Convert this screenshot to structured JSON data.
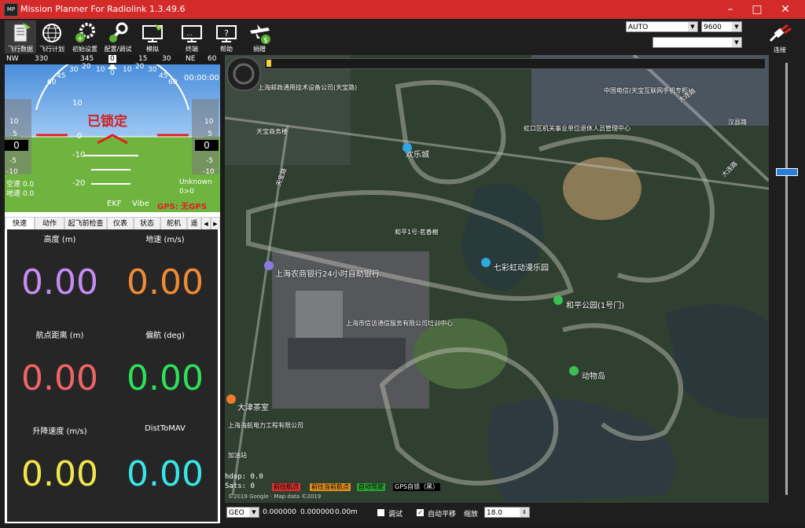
{
  "window": {
    "title": "Mission Planner For Radiolink 1.3.49.6",
    "icon_text": "MP"
  },
  "toolbar": {
    "items": [
      {
        "label": "飞行数据",
        "icon": "flight-data-icon"
      },
      {
        "label": "飞行计划",
        "icon": "flight-plan-icon"
      },
      {
        "label": "初始设置",
        "icon": "initial-setup-icon"
      },
      {
        "label": "配置/调试",
        "icon": "config-tuning-icon"
      },
      {
        "label": "模拟",
        "icon": "simulation-icon"
      },
      {
        "label": "终端",
        "icon": "terminal-icon"
      },
      {
        "label": "帮助",
        "icon": "help-icon"
      },
      {
        "label": "捐赠",
        "icon": "donate-icon"
      }
    ],
    "port_value": "AUTO",
    "baud_value": "9600",
    "profile_value": "",
    "connect_label": "连接"
  },
  "hud": {
    "heading_labels": [
      "NW",
      "330",
      "345",
      "0",
      "15",
      "30",
      "NE",
      "60"
    ],
    "heading_value": "0",
    "time": "00:00:00",
    "status_banner": "已锁定",
    "left_scale": [
      "10",
      "5",
      "-5",
      "-10"
    ],
    "left_box": "0",
    "right_scale": [
      "10",
      "5",
      "-5",
      "-10"
    ],
    "right_box": "0",
    "pitch_labels": [
      "10",
      "0",
      "-10",
      "-20"
    ],
    "roll_labels": [
      "60",
      "45",
      "30",
      "20",
      "10",
      "0",
      "10",
      "20",
      "30",
      "45",
      "60"
    ],
    "airspeed": "空速 0.0",
    "groundspeed": "地速 0.0",
    "unknown": "Unknown",
    "wp": "0>0",
    "ekf": "EKF",
    "vibe": "Vibe",
    "gps": "GPS: 无GPS"
  },
  "tabs": [
    "快速",
    "动作",
    "起飞前检查",
    "仪表",
    "状态",
    "舵机",
    "遥"
  ],
  "quick": [
    {
      "label": "高度 (m)",
      "value": "0.00",
      "color": "#c58cf2"
    },
    {
      "label": "地速 (m/s)",
      "value": "0.00",
      "color": "#f08a34"
    },
    {
      "label": "航点距离 (m)",
      "value": "0.00",
      "color": "#f06464"
    },
    {
      "label": "偏航 (deg)",
      "value": "0.00",
      "color": "#2de05a"
    },
    {
      "label": "升降速度 (m/s)",
      "value": "0.00",
      "color": "#f2e64c"
    },
    {
      "label": "DistToMAV",
      "value": "0.00",
      "color": "#38e6e8"
    }
  ],
  "map": {
    "labels": [
      {
        "text": "上海邮政通用技术设备公司(天宝路)"
      },
      {
        "text": "中国电信(天宝互联网手机专柜)"
      },
      {
        "text": "大连路"
      },
      {
        "text": "天宝商务楼"
      },
      {
        "text": "欢乐城"
      },
      {
        "text": "虹口区机关事业单位退休人员管理中心"
      },
      {
        "text": "天宝路"
      },
      {
        "text": "和平1号·茗香榭"
      },
      {
        "text": "七彩虹动漫乐园"
      },
      {
        "text": "上海农商银行24小时自助银行"
      },
      {
        "text": "和平公园(1号门)"
      },
      {
        "text": "上海市信访通信服务有限公司培训中心"
      },
      {
        "text": "动物岛"
      },
      {
        "text": "大津茶室"
      },
      {
        "text": "上海海航电力工程有限公司"
      },
      {
        "text": "加油站"
      },
      {
        "text": "大连路"
      },
      {
        "text": "汉县路"
      }
    ],
    "hdop": "hdop: 0.0",
    "sats": "Sats: 0",
    "chips": [
      {
        "text": "前往航点",
        "color": "#d93030"
      },
      {
        "text": "前往当前航点",
        "color": "#e09020"
      },
      {
        "text": "自动驾驶",
        "color": "#2aa030"
      },
      {
        "text": "GPS自锁（黑）",
        "color": "#000000"
      }
    ],
    "copyright": "©2019 Google · Map data ©2019"
  },
  "bottom": {
    "coord_type": "GEO",
    "lat": "0.000000",
    "lng": "0.000000",
    "alt": "0.00m",
    "debug_label": "调试",
    "autopan_label": "自动平移",
    "zoom_label": "缩放",
    "zoom_value": "18.0"
  }
}
